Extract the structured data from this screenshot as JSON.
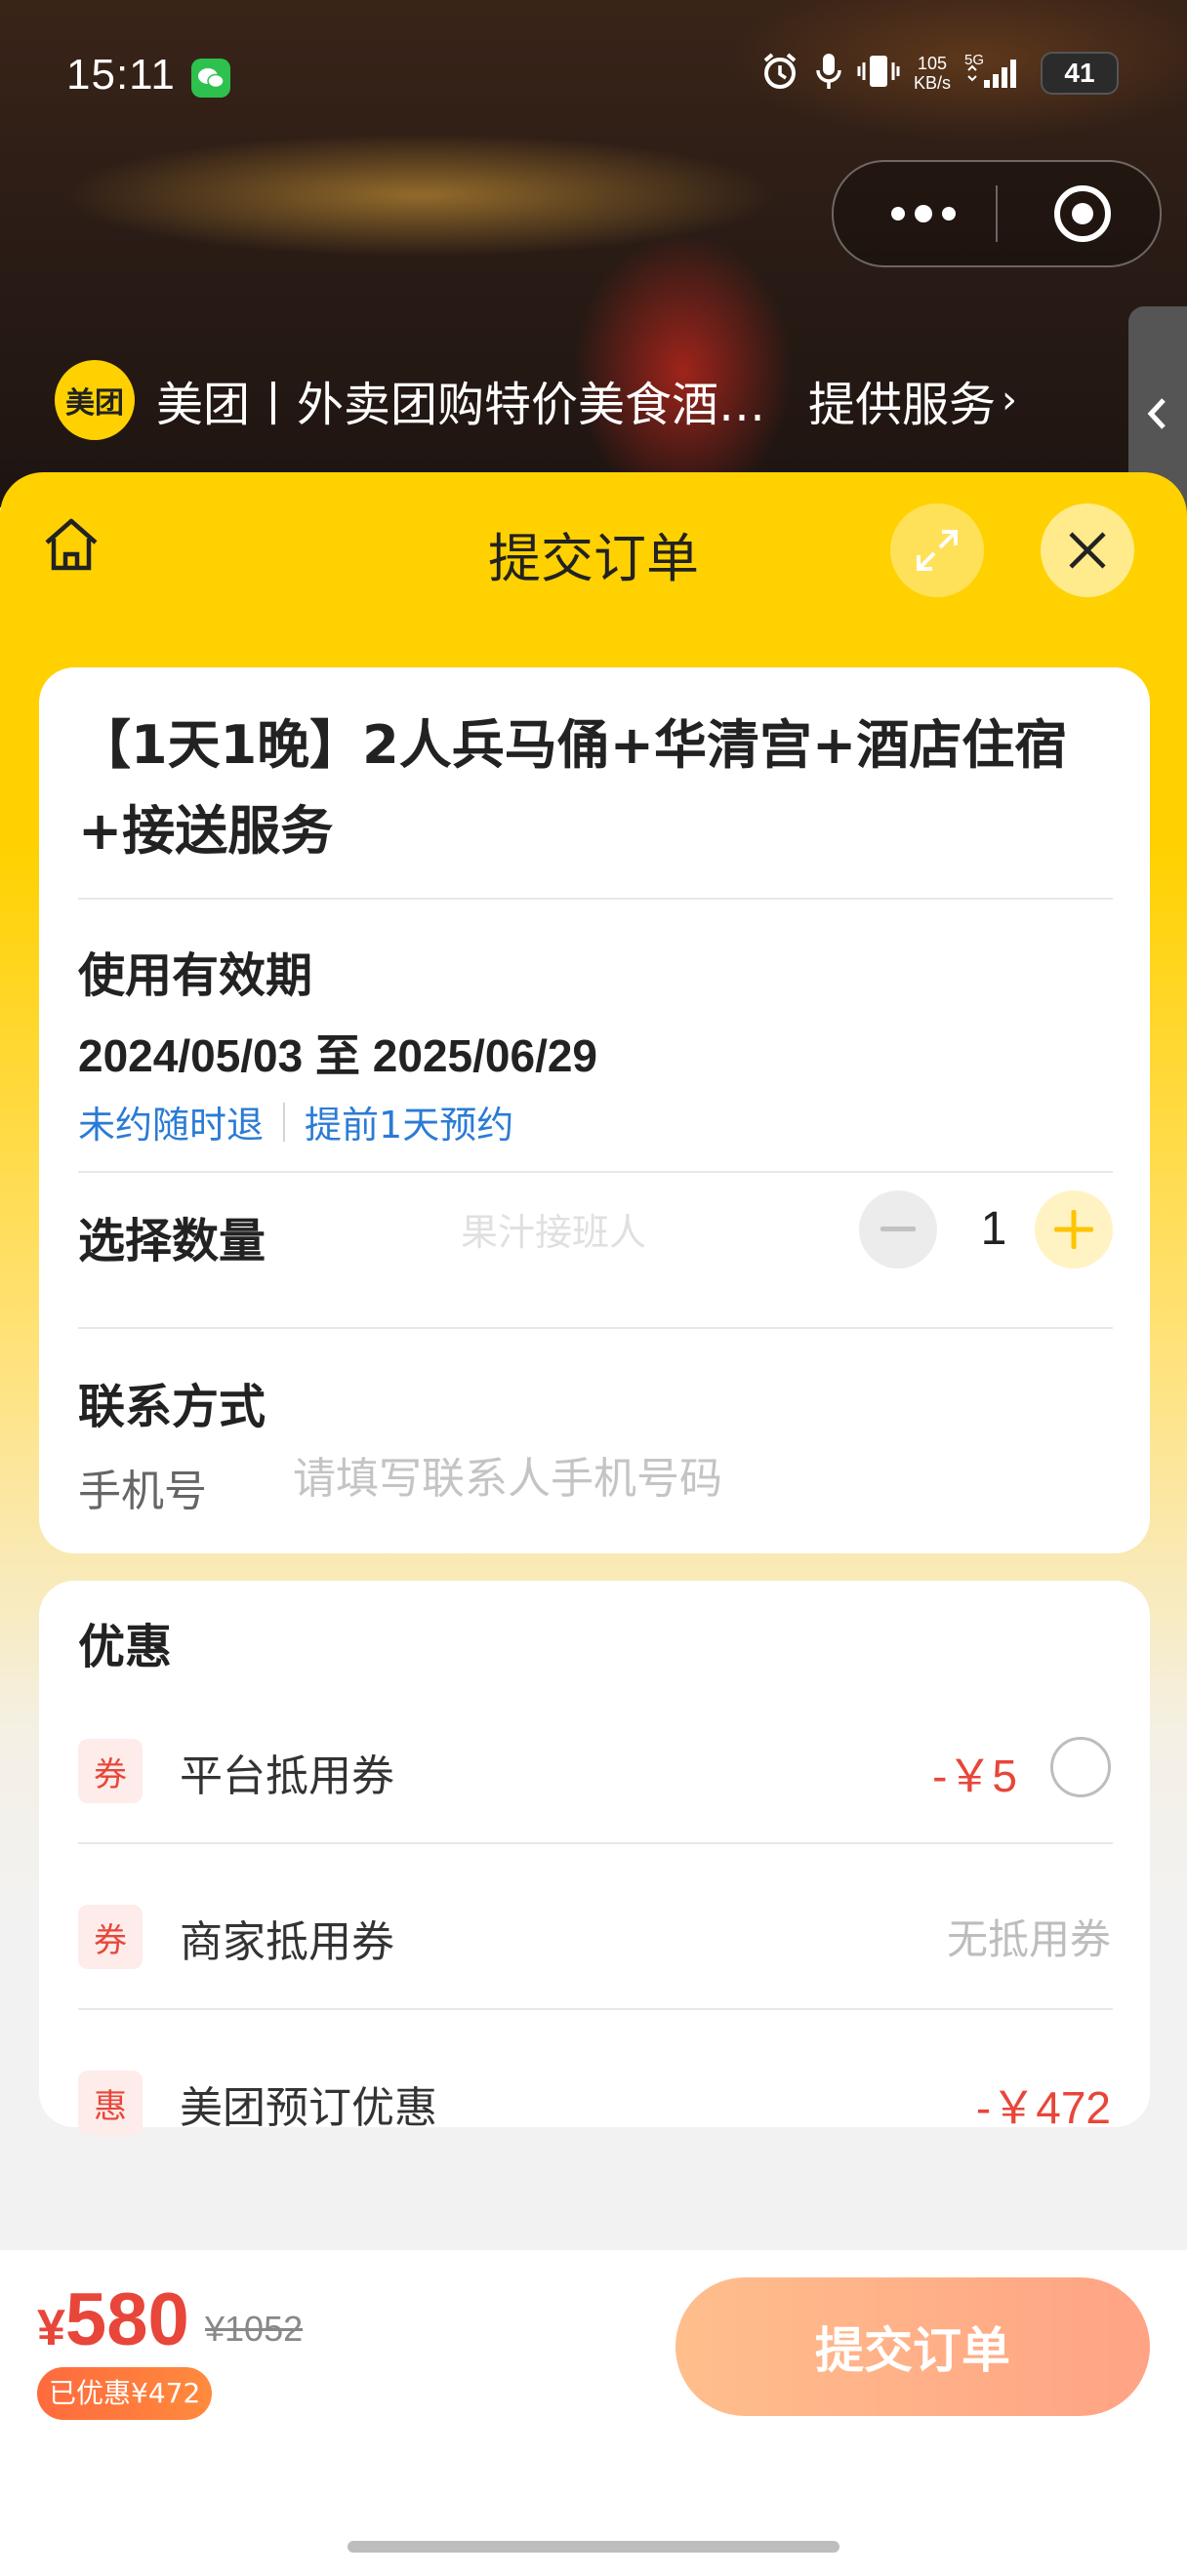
{
  "status_bar": {
    "time": "15:11",
    "net_speed_top": "105",
    "net_speed_bottom": "KB/s",
    "network": "5G",
    "battery": "41"
  },
  "mini_program": {
    "logo_text": "美团",
    "title": "美团丨外卖团购特价美食酒…",
    "service_link": "提供服务"
  },
  "page": {
    "title": "提交订单"
  },
  "product": {
    "title": "【1天1晚】2人兵马俑+华清宫+酒店住宿+接送服务"
  },
  "validity": {
    "label": "使用有效期",
    "dates": "2024/05/03 至 2025/06/29",
    "policy_1": "未约随时退",
    "policy_2": "提前1天预约"
  },
  "quantity": {
    "label": "选择数量",
    "watermark": "果汁接班人",
    "value": "1"
  },
  "contact": {
    "label": "联系方式",
    "phone_label": "手机号",
    "phone_placeholder": "请填写联系人手机号码"
  },
  "discounts": {
    "label": "优惠",
    "items": [
      {
        "tag": "券",
        "name": "平台抵用券",
        "value": "-￥5"
      },
      {
        "tag": "券",
        "name": "商家抵用券",
        "value": "无抵用券"
      },
      {
        "tag": "惠",
        "name": "美团预订优惠",
        "value": "-￥472"
      }
    ]
  },
  "footer": {
    "currency": "¥",
    "price": "580",
    "original_price": "¥1052",
    "saved": "已优惠¥472",
    "submit_label": "提交订单"
  },
  "colors": {
    "brand_yellow": "#ffd100",
    "discount_red": "#e8463a",
    "link_blue": "#2b7bd6",
    "submit_gradient": "#ffbe8c"
  }
}
